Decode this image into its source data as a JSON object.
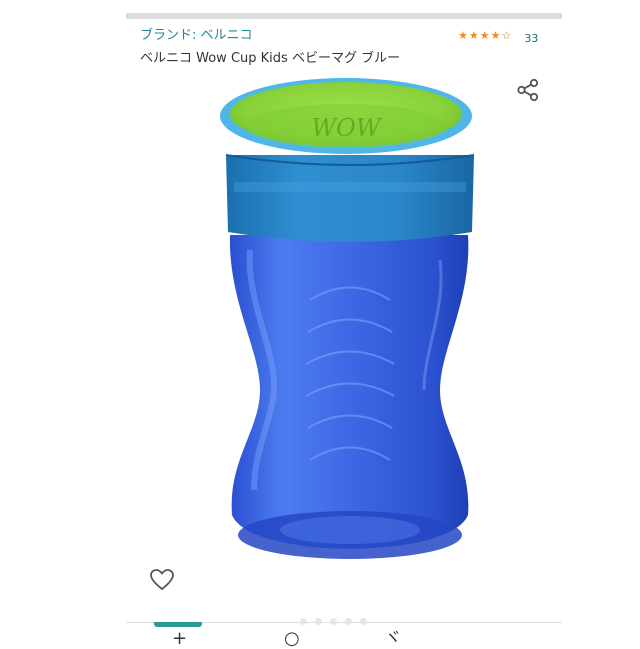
{
  "product": {
    "brand_label": "ブランド: ベルニコ",
    "title": "ベルニコ Wow Cup Kids ベビーマグ ブルー",
    "rating": {
      "stars": 4,
      "max": 5,
      "count": "33"
    },
    "image_alt": "Wow Cup Kids blue sippy cup with green lid",
    "cup_logo_text": "WOW"
  },
  "icons": {
    "share": "share-icon",
    "wishlist": "heart-icon"
  },
  "carousel": {
    "total": 5
  },
  "colors": {
    "brand_link": "#1a8a95",
    "star": "#f08b1e",
    "tab_accent": "#2a9a97"
  }
}
